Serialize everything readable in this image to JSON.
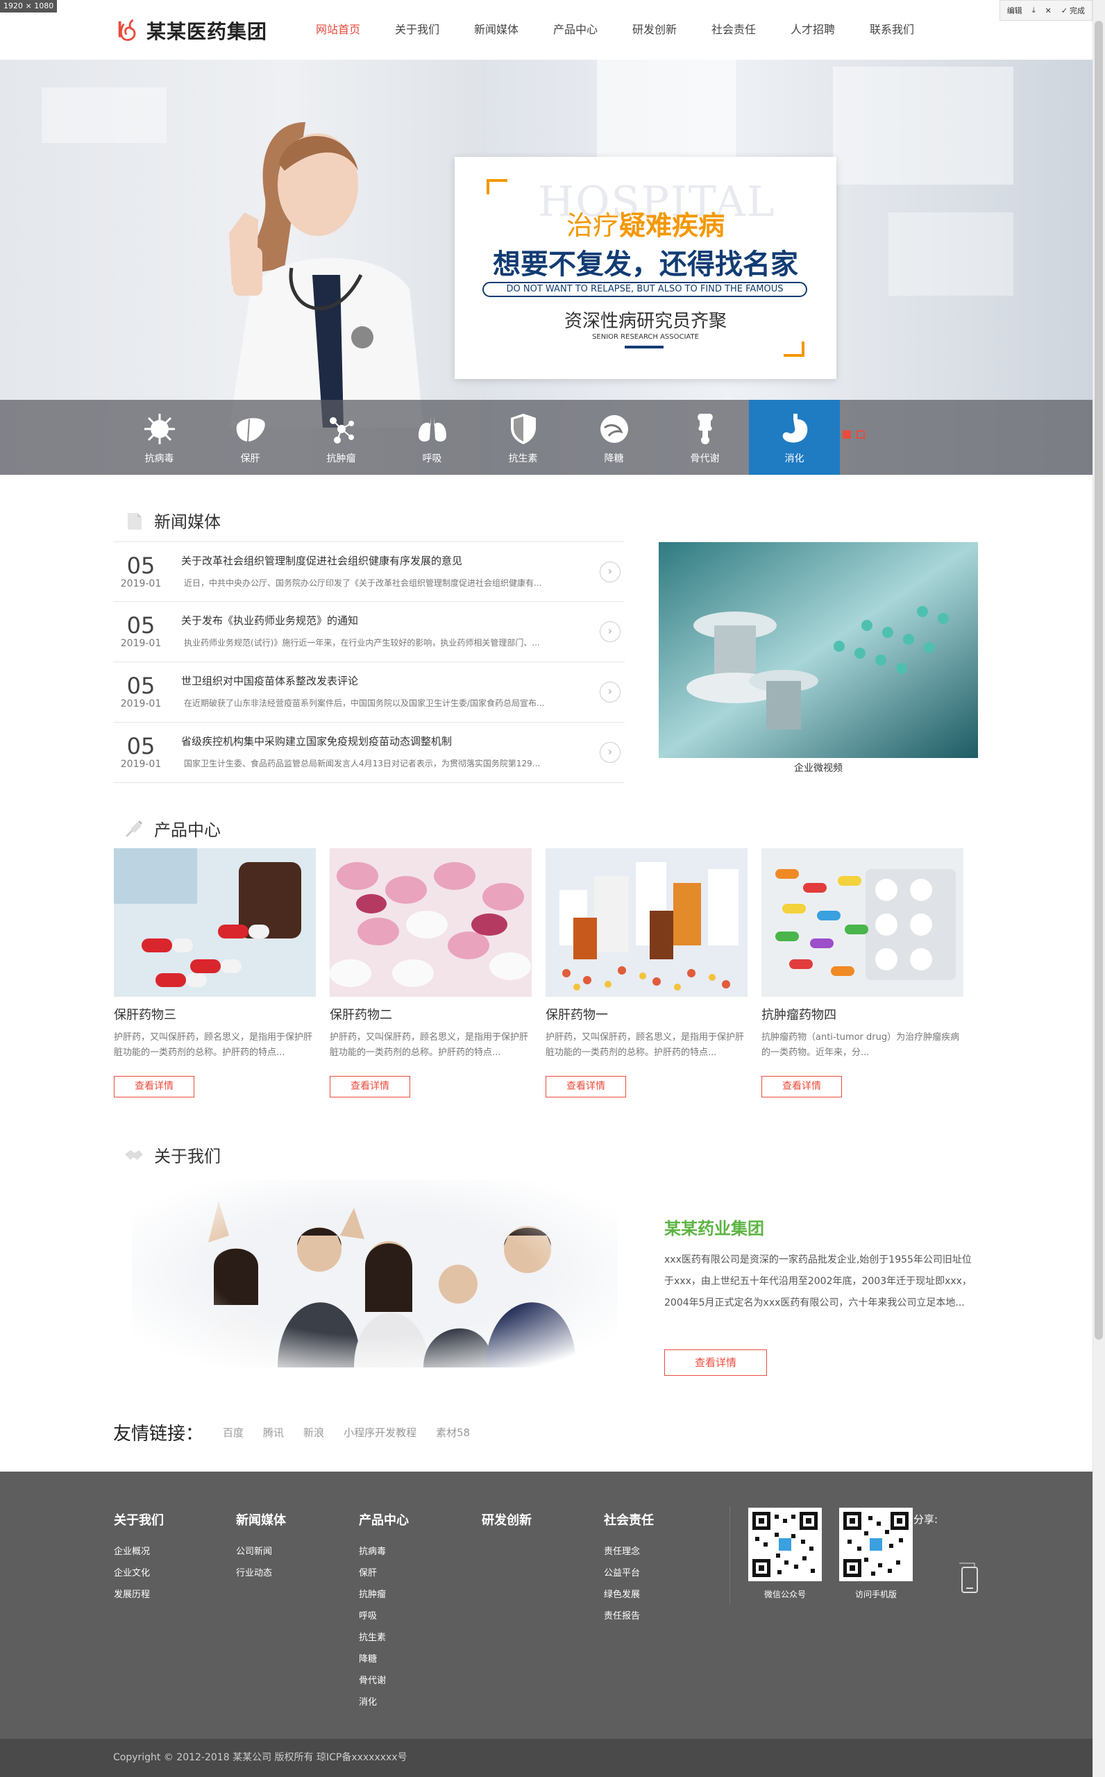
{
  "screen_tag": "1920 × 1080",
  "toolbar": {
    "edit": "编辑",
    "done": "完成"
  },
  "header": {
    "logo_text": "某某医药集团",
    "nav": [
      "网站首页",
      "关于我们",
      "新闻媒体",
      "产品中心",
      "研发创新",
      "社会责任",
      "人才招聘",
      "联系我们"
    ],
    "active_index": 0
  },
  "banner": {
    "bg_word": "HOSPITAL",
    "line1_a": "治疗",
    "line1_b": "疑难疾病",
    "line2": "想要不复发，还得找名家",
    "pill": "DO NOT WANT TO RELAPSE, BUT ALSO TO FIND THE FAMOUS",
    "line3": "资深性病研究员齐聚",
    "line4": "SENIOR RESEARCH ASSOCIATE",
    "slides": 2,
    "active_slide": 0
  },
  "categories": [
    {
      "label": "抗病毒",
      "icon": "virus-icon"
    },
    {
      "label": "保肝",
      "icon": "liver-icon"
    },
    {
      "label": "抗肿瘤",
      "icon": "molecule-icon"
    },
    {
      "label": "呼吸",
      "icon": "lungs-icon"
    },
    {
      "label": "抗生素",
      "icon": "shield-icon"
    },
    {
      "label": "降糖",
      "icon": "pancreas-icon"
    },
    {
      "label": "骨代谢",
      "icon": "bone-icon"
    },
    {
      "label": "消化",
      "icon": "stomach-icon"
    }
  ],
  "active_category": 7,
  "news": {
    "title": "新闻媒体",
    "items": [
      {
        "day": "05",
        "ym": "2019-01",
        "title": "关于改革社会组织管理制度促进社会组织健康有序发展的意见",
        "desc": "近日，中共中央办公厅、国务院办公厅印发了《关于改革社会组织管理制度促进社会组织健康有..."
      },
      {
        "day": "05",
        "ym": "2019-01",
        "title": "关于发布《执业药师业务规范》的通知",
        "desc": "执业药师业务规范(试行)》施行近一年来，在行业内产生较好的影响，执业药师相关管理部门、..."
      },
      {
        "day": "05",
        "ym": "2019-01",
        "title": "世卫组织对中国疫苗体系整改发表评论",
        "desc": "在近期破获了山东非法经营疫苗系列案件后，中国国务院以及国家卫生计生委/国家食药总局宣布..."
      },
      {
        "day": "05",
        "ym": "2019-01",
        "title": "省级疾控机构集中采购建立国家免疫规划疫苗动态调整机制",
        "desc": "国家卫生计生委、食品药品监管总局新闻发言人4月13日对记者表示，为贯彻落实国务院第129..."
      }
    ],
    "video_caption": "企业微视频"
  },
  "products": {
    "title": "产品中心",
    "items": [
      {
        "name": "保肝药物三",
        "desc": "护肝药，又叫保肝药，顾名思义，是指用于保护肝脏功能的一类药剂的总称。护肝药的特点...",
        "btn": "查看详情"
      },
      {
        "name": "保肝药物二",
        "desc": "护肝药，又叫保肝药，顾名思义，是指用于保护肝脏功能的一类药剂的总称。护肝药的特点...",
        "btn": "查看详情"
      },
      {
        "name": "保肝药物一",
        "desc": "护肝药，又叫保肝药，顾名思义，是指用于保护肝脏功能的一类药剂的总称。护肝药的特点...",
        "btn": "查看详情"
      },
      {
        "name": "抗肿瘤药物四",
        "desc": "抗肿瘤药物（anti-tumor drug）为治疗肿瘤疾病的一类药物。近年来，分...",
        "btn": "查看详情"
      }
    ]
  },
  "about": {
    "title": "关于我们",
    "heading": "某某药业集团",
    "text": "xxx医药有限公司是资深的一家药品批发企业,始创于1955年公司旧址位于xxx，由上世纪五十年代沿用至2002年底，2003年迁于现址即xxx，2004年5月正式定名为xxx医药有限公司，六十年来我公司立足本地...",
    "btn": "查看详情"
  },
  "links": {
    "title": "友情链接：",
    "items": [
      "百度",
      "腾讯",
      "新浪",
      "小程序开发教程",
      "素材58"
    ]
  },
  "footer": {
    "cols": [
      {
        "title": "关于我们",
        "items": [
          "企业概况",
          "企业文化",
          "发展历程"
        ]
      },
      {
        "title": "新闻媒体",
        "items": [
          "公司新闻",
          "行业动态"
        ]
      },
      {
        "title": "产品中心",
        "items": [
          "抗病毒",
          "保肝",
          "抗肿瘤",
          "呼吸",
          "抗生素",
          "降糖",
          "骨代谢",
          "消化"
        ]
      },
      {
        "title": "研发创新",
        "items": []
      },
      {
        "title": "社会责任",
        "items": [
          "责任理念",
          "公益平台",
          "绿色发展",
          "责任报告"
        ]
      }
    ],
    "qr": [
      {
        "label": "微信公众号"
      },
      {
        "label": "访问手机版"
      }
    ],
    "share": "分享:",
    "copyright": "Copyright © 2012-2018 某某公司 版权所有  琼ICP备xxxxxxxx号"
  },
  "colors": {
    "accent": "#e94c3d",
    "blue": "#1f7bc2",
    "navy": "#123c73",
    "orange": "#f39800",
    "green": "#5db442",
    "footer": "#5e5e5e"
  }
}
